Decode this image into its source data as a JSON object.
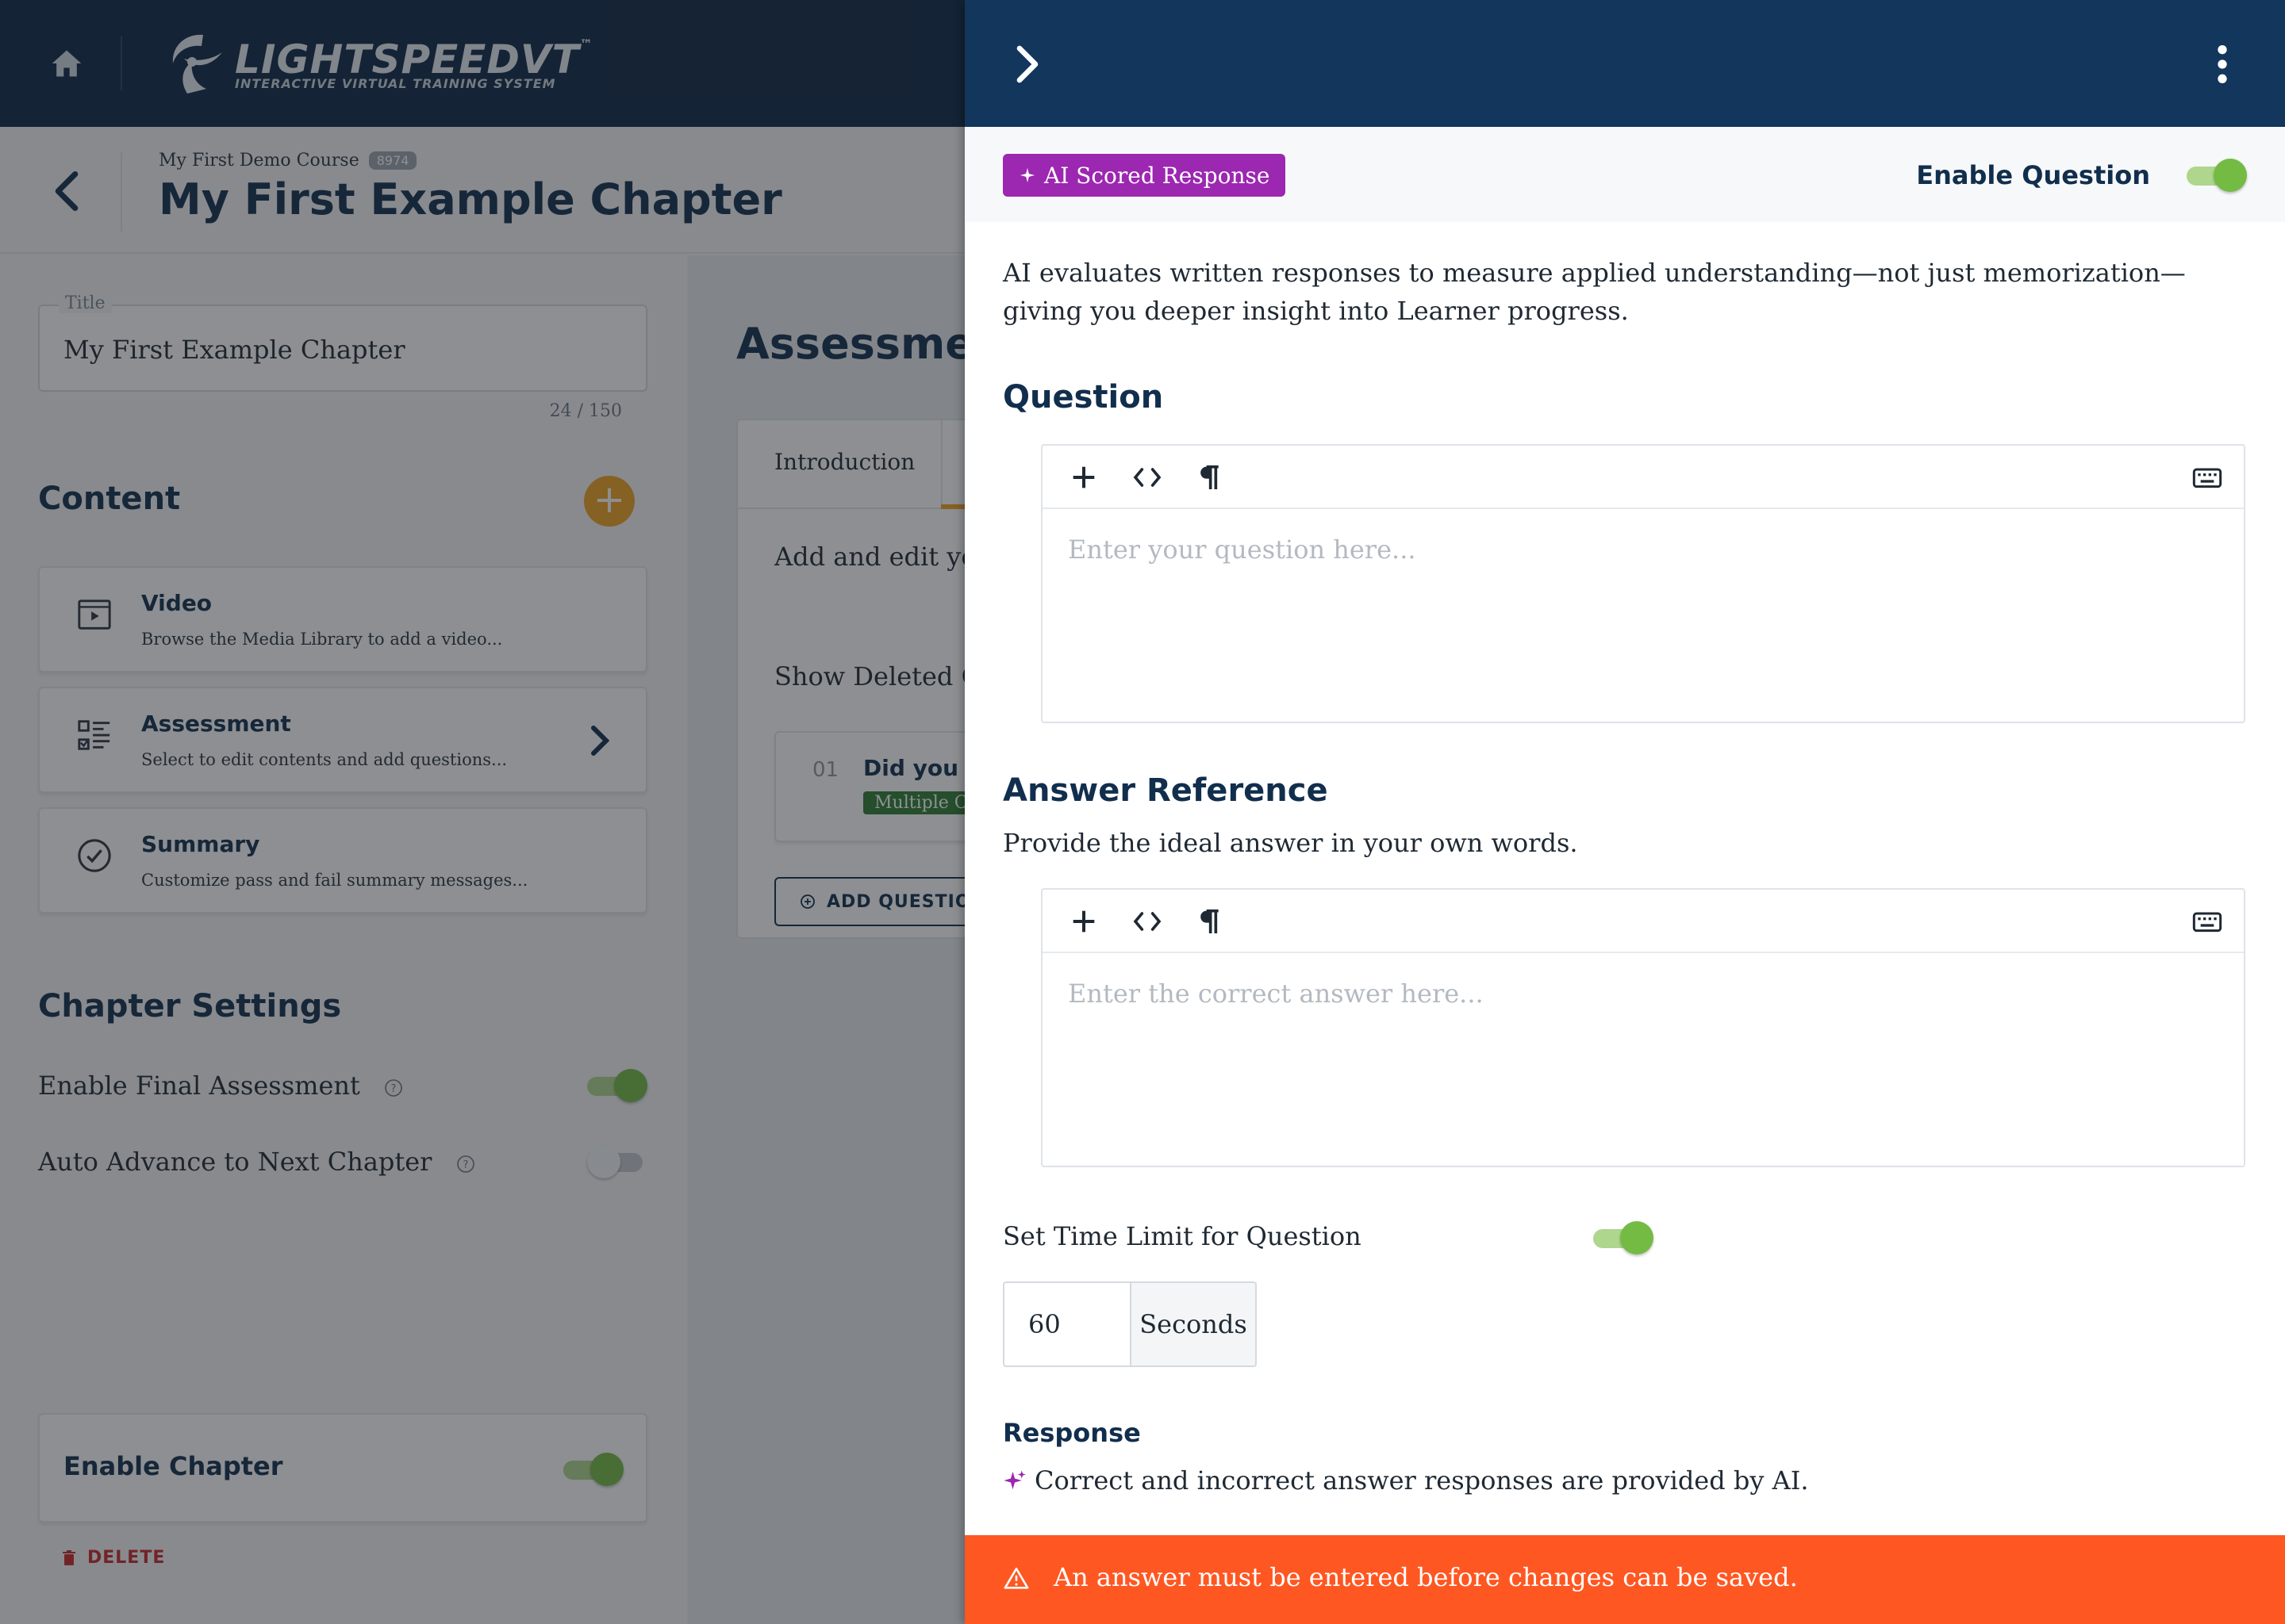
{
  "app": {
    "logo_text": "LIGHTSPEEDVT",
    "logo_tm": "™",
    "logo_tagline": "INTERACTIVE VIRTUAL TRAINING SYSTEM"
  },
  "header": {
    "course_name": "My First Demo Course",
    "course_id": "8974",
    "chapter_title": "My First Example Chapter"
  },
  "title_field": {
    "label": "Title",
    "value": "My First Example Chapter",
    "char_count": "24 / 150"
  },
  "content": {
    "heading": "Content",
    "add_button": "+",
    "items": [
      {
        "title": "Video",
        "description": "Browse the Media Library to add a video...",
        "icon": "video-icon"
      },
      {
        "title": "Assessment",
        "description": "Select to edit contents and add questions...",
        "icon": "checklist-icon"
      },
      {
        "title": "Summary",
        "description": "Customize pass and fail summary messages...",
        "icon": "check-circle-icon"
      }
    ]
  },
  "chapter_settings": {
    "heading": "Chapter Settings",
    "enable_final_assessment": {
      "label": "Enable Final Assessment",
      "on": true
    },
    "auto_advance": {
      "label": "Auto Advance to Next Chapter",
      "on": false
    }
  },
  "enable_chapter": {
    "label": "Enable Chapter",
    "on": true
  },
  "delete_label": "DELETE",
  "assessment": {
    "heading": "Assessment",
    "tab_introduction": "Introduction",
    "description": "Add and edit your questions, attempt under the",
    "show_deleted": "Show Deleted Questions",
    "questions": [
      {
        "number": "01",
        "title": "Did you understand",
        "type": "Multiple Choice"
      }
    ],
    "add_question_label": "ADD QUESTION"
  },
  "drawer": {
    "badge_label": "AI Scored Response",
    "enable_question": {
      "label": "Enable Question",
      "on": true
    },
    "description": "AI evaluates written responses to measure applied understanding—not just memorization—giving you deeper insight into Learner progress.",
    "question_heading": "Question",
    "question_placeholder": "Enter your question here...",
    "answer_heading": "Answer Reference",
    "answer_help": "Provide the ideal answer in your own words.",
    "answer_placeholder": "Enter the correct answer here...",
    "time_limit": {
      "label": "Set Time Limit for Question",
      "on": true,
      "value": "60",
      "unit": "Seconds"
    },
    "response_heading": "Response",
    "response_text": "Correct and incorrect answer responses are provided by AI.",
    "error_message": "An answer must be entered before changes can be saved."
  },
  "colors": {
    "navy": "#0d2744",
    "drawer_header": "#12365c",
    "accent_orange": "#f0a323",
    "ai_purple": "#9c27b0",
    "toggle_green": "#74bb44",
    "error_orange": "#ff5722"
  }
}
